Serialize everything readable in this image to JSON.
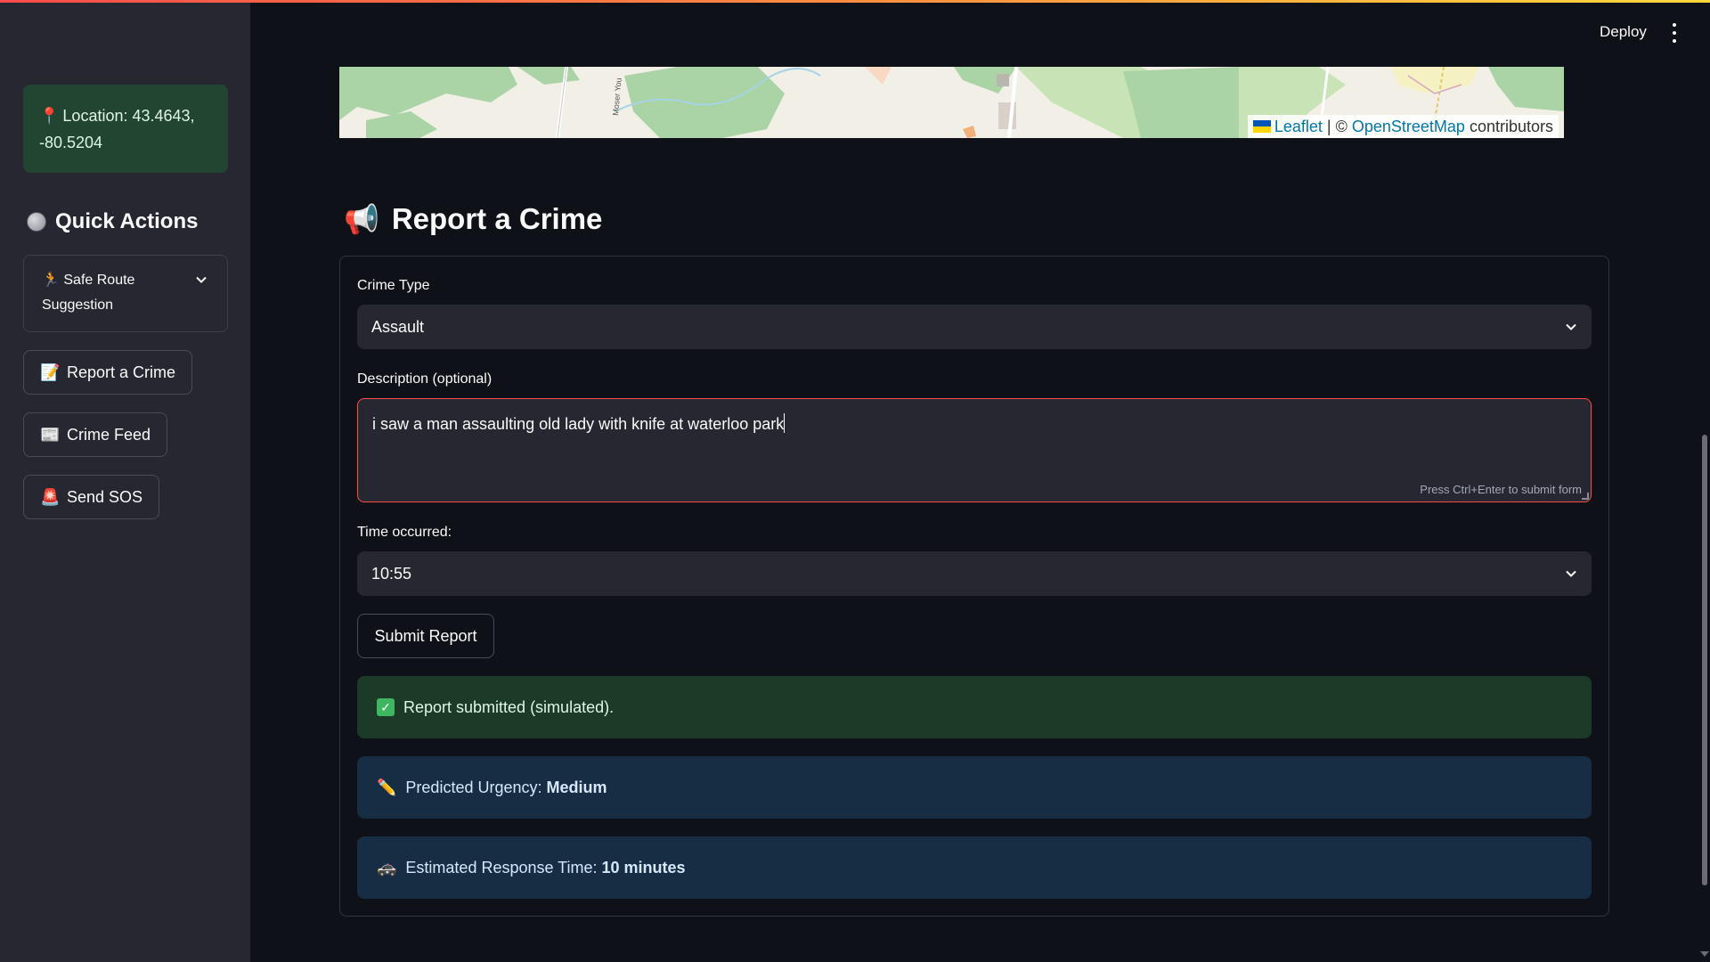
{
  "header": {
    "deploy_label": "Deploy",
    "menu_icon": "kebab-menu-icon"
  },
  "sidebar": {
    "location_text": "Location: 43.4643, -80.5204",
    "location_icon": "pin-icon",
    "quick_actions_title": "Quick Actions",
    "expander_label": "Safe Route Suggestion",
    "expander_icon": "walking-person-icon",
    "buttons": [
      {
        "label": "Report a Crime",
        "icon": "memo-icon"
      },
      {
        "label": "Crime Feed",
        "icon": "newspaper-icon"
      },
      {
        "label": "Send SOS",
        "icon": "siren-icon"
      }
    ]
  },
  "map": {
    "road_label": "Moser You",
    "attribution_leaflet": "Leaflet",
    "attribution_sep": " | © ",
    "attribution_osm": "OpenStreetMap",
    "attribution_tail": " contributors"
  },
  "main": {
    "title": "Report a Crime",
    "title_icon": "megaphone-icon"
  },
  "form": {
    "crime_type_label": "Crime Type",
    "crime_type_value": "Assault",
    "description_label": "Description (optional)",
    "description_value": "i saw a man assaulting old lady with knife at waterloo park",
    "hint": "Press Ctrl+Enter to submit form",
    "time_label": "Time occurred:",
    "time_value": "10:55",
    "submit_label": "Submit Report"
  },
  "alerts": {
    "success_text": "Report submitted (simulated).",
    "urgency_prefix": "Predicted Urgency: ",
    "urgency_value": "Medium",
    "response_prefix": "Estimated Response Time: ",
    "response_value": "10 minutes"
  },
  "colors": {
    "accent_red": "#ff4b4b",
    "success_bg": "#1b3b28",
    "info_bg": "#172d43",
    "sidebar_bg": "#262730",
    "page_bg": "#0e1117"
  }
}
